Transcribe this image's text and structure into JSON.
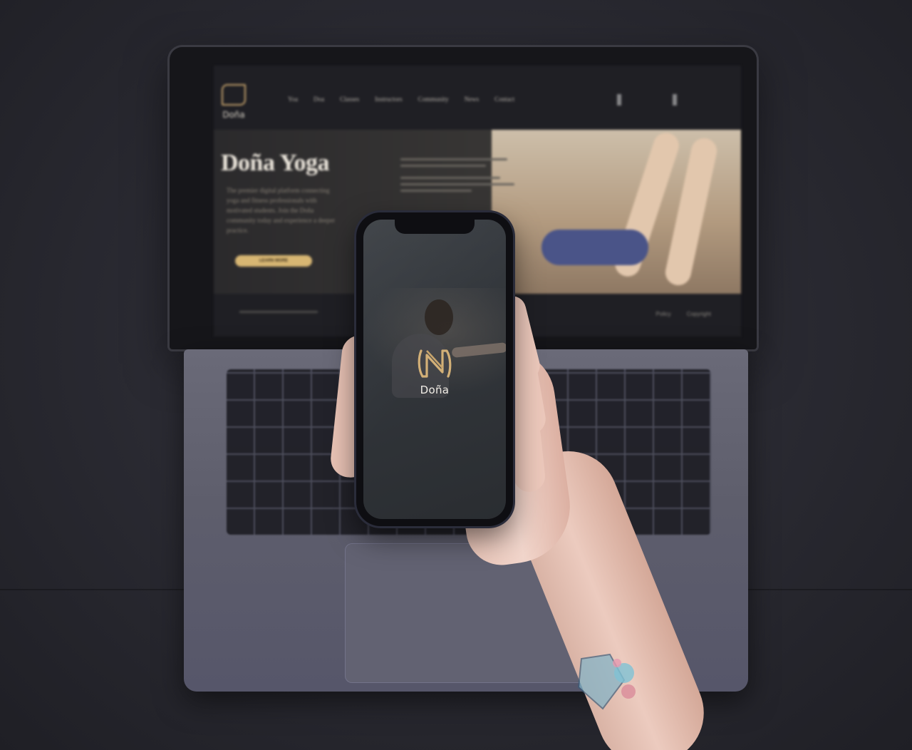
{
  "laptop_site": {
    "brand": "Doña",
    "nav": [
      "Yoa",
      "Doa",
      "Classes",
      "Instructors",
      "Community",
      "News",
      "Contact"
    ],
    "hero_title": "Doña Yoga",
    "hero_text": "The premier digital platform connecting yoga and fitness professionals with motivated students. Join the Doña community today and experience a deeper practice.",
    "cta_label": "LEARN MORE",
    "footer_links": [
      "Policy",
      "Copyright"
    ]
  },
  "phone_app": {
    "app_name": "Doña"
  },
  "colors": {
    "accent_gold": "#c7a46c",
    "phone_bg": "#32363b",
    "site_dark": "#1f1f24"
  }
}
